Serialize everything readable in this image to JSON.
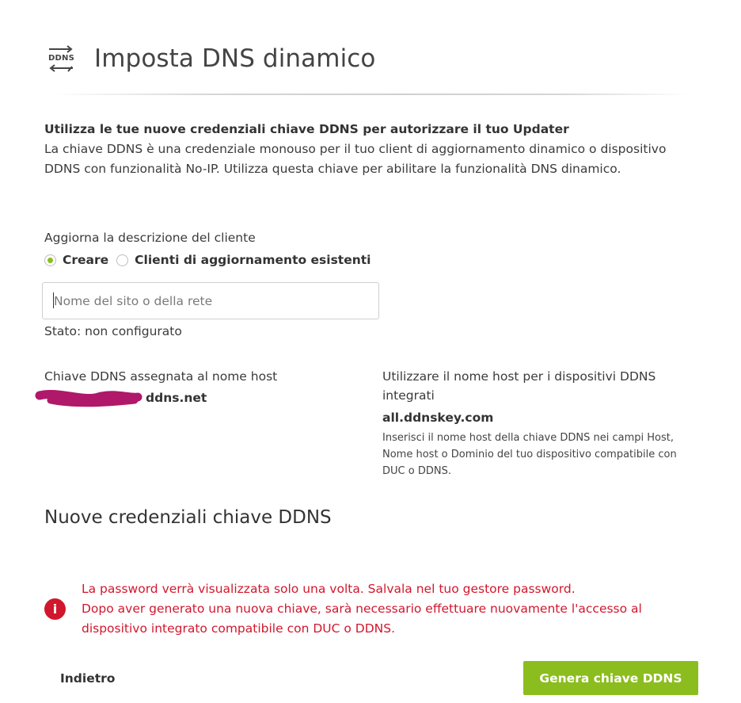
{
  "header": {
    "icon": "ddns-icon",
    "icon_text": "DDNS",
    "title": "Imposta DNS dinamico"
  },
  "intro": {
    "heading": "Utilizza le tue nuove credenziali chiave DDNS per autorizzare il tuo Updater",
    "body": "La chiave DDNS è una credenziale monouso per il tuo client di aggiornamento dinamico o dispositivo DDNS con funzionalità No-IP. Utilizza questa chiave per abilitare la funzionalità DNS dinamico."
  },
  "client": {
    "label": "Aggiorna la descrizione del cliente",
    "options": [
      {
        "label": "Creare",
        "selected": true
      },
      {
        "label": "Clienti di aggiornamento esistenti",
        "selected": false
      }
    ],
    "input_placeholder": "Nome del sito o della rete",
    "input_value": "",
    "status": "Stato: non configurato"
  },
  "hostname_key": {
    "label": "Chiave DDNS assegnata al nome host",
    "hostname_visible": "ddns.net"
  },
  "integrated": {
    "label": "Utilizzare il nome host per i dispositivi DDNS integrati",
    "host": "all.ddnskey.com",
    "help": "Inserisci il nome host della chiave DDNS nei campi Host, Nome host o Dominio del tuo dispositivo compatibile con DUC o DDNS."
  },
  "credentials": {
    "title": "Nuove credenziali chiave DDNS"
  },
  "alert": {
    "icon": "info-icon",
    "icon_glyph": "i",
    "line1": "La password verrà visualizzata solo una volta. Salvala nel tuo gestore password.",
    "line2": "Dopo aver generato una nuova chiave, sarà necessario effettuare nuovamente l'accesso al dispositivo integrato compatibile con DUC o DDNS."
  },
  "actions": {
    "back_label": "Indietro",
    "generate_label": "Genera chiave DDNS"
  },
  "colors": {
    "accent": "#8bbd1e",
    "error": "#d1172d",
    "redaction": "#b0186a"
  }
}
